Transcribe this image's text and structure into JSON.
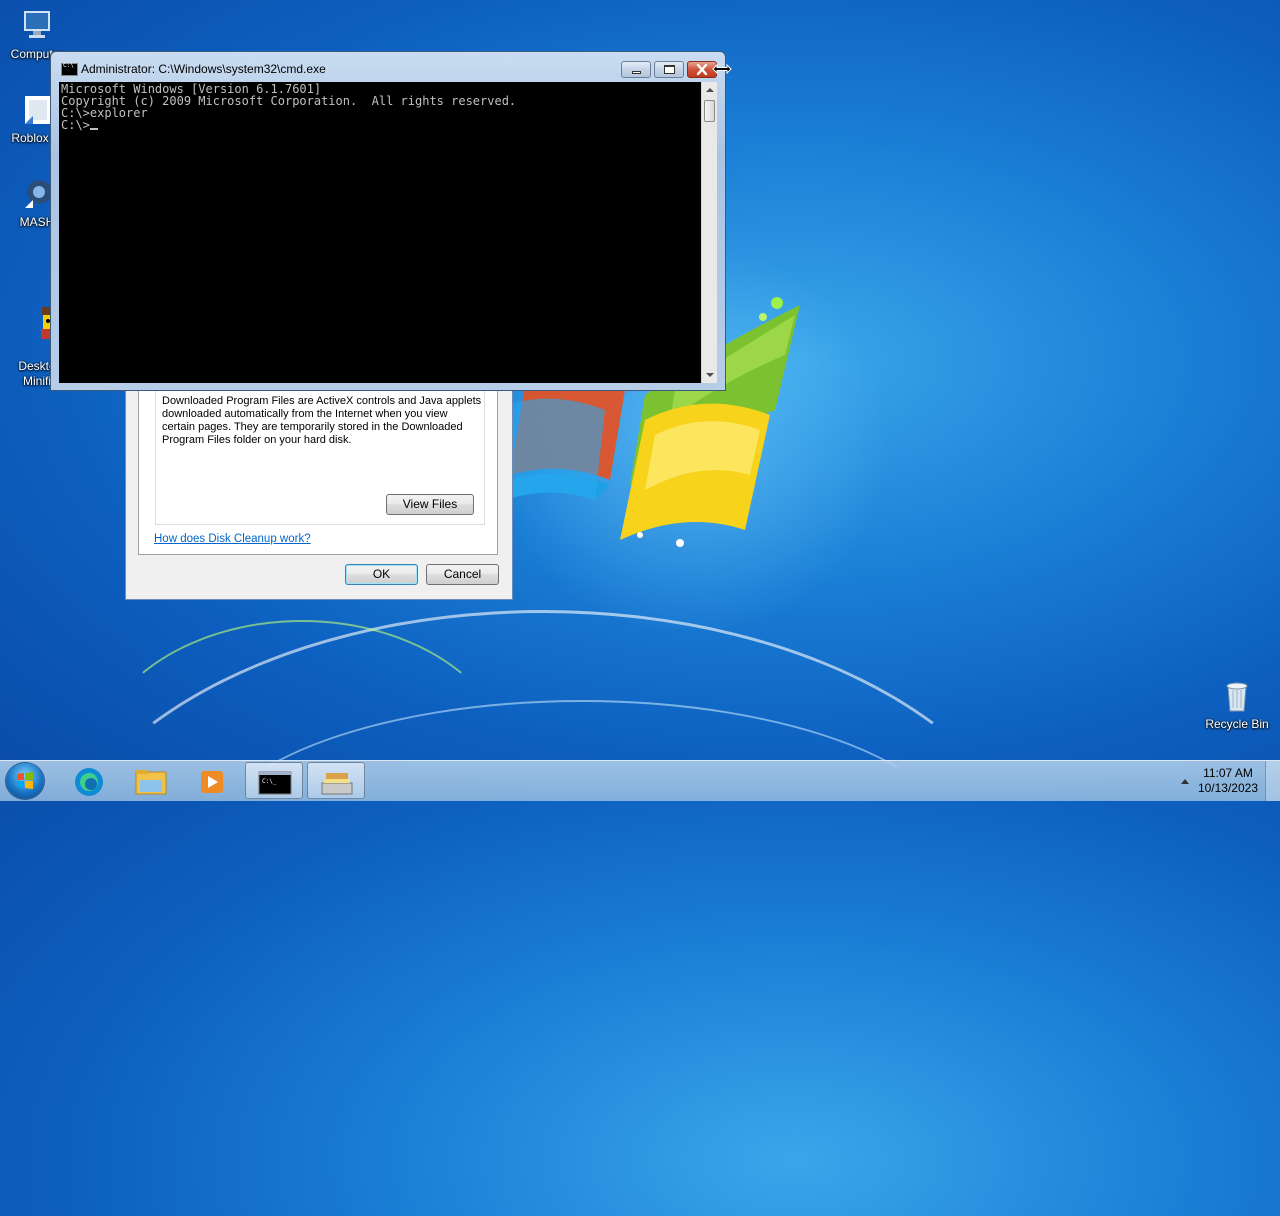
{
  "desktop": {
    "icons": [
      {
        "label": "Computer",
        "icon": "computer-icon"
      },
      {
        "label": "Roblox Pl",
        "icon": "roblox-icon"
      },
      {
        "label": "MASH",
        "icon": "mash-icon"
      },
      {
        "label": "Deskto\nMinifi",
        "icon": "minifigure-icon"
      },
      {
        "label": "Recycle Bin",
        "icon": "recycle-bin-icon"
      }
    ]
  },
  "cmd": {
    "title": "Administrator: C:\\Windows\\system32\\cmd.exe",
    "lines": [
      "Microsoft Windows [Version 6.1.7601]",
      "Copyright (c) 2009 Microsoft Corporation.  All rights reserved.",
      "",
      "C:\\>explorer",
      "",
      "C:\\>"
    ]
  },
  "disk_cleanup": {
    "description": "Downloaded Program Files are ActiveX controls and Java applets downloaded automatically from the Internet when you view certain pages. They are temporarily stored in the Downloaded Program Files folder on your hard disk.",
    "view_files_label": "View Files",
    "help_link": "How does Disk Cleanup work?",
    "ok_label": "OK",
    "cancel_label": "Cancel"
  },
  "taskbar": {
    "pinned": [
      {
        "name": "edge-icon",
        "active": false
      },
      {
        "name": "file-explorer-icon",
        "active": false
      },
      {
        "name": "media-player-icon",
        "active": false
      },
      {
        "name": "cmd-icon",
        "active": true
      },
      {
        "name": "disk-cleanup-icon",
        "active": true
      }
    ],
    "time": "11:07 AM",
    "date": "10/13/2023"
  }
}
